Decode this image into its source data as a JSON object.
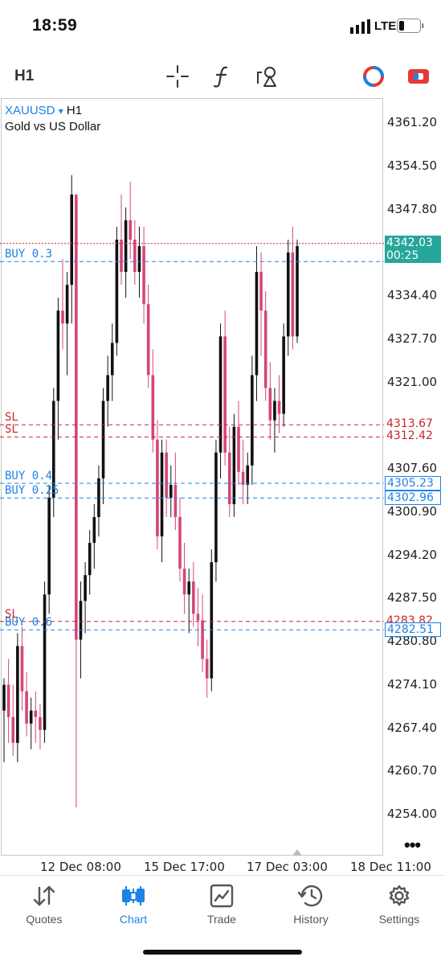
{
  "status_bar": {
    "time": "18:59",
    "network": "LTE"
  },
  "toolbar": {
    "timeframe": "H1",
    "icons": [
      "crosshair-icon",
      "function-icon",
      "objects-icon",
      "trade-recorder-icon",
      "one-click-trade-icon"
    ]
  },
  "symbol": {
    "name": "XAUUSD",
    "arrow": "▾",
    "timeframe": "H1",
    "description": "Gold vs US Dollar"
  },
  "price_axis": {
    "labels": [
      "4361.20",
      "4354.50",
      "4347.80",
      "4334.40",
      "4327.70",
      "4321.00",
      "4307.60",
      "4300.90",
      "4294.20",
      "4287.50",
      "4280.80",
      "4274.10",
      "4267.40",
      "4260.70",
      "4254.00"
    ]
  },
  "time_axis": {
    "labels": [
      "12 Dec 08:00",
      "15 Dec 17:00",
      "17 Dec 03:00",
      "18 Dec 11:00"
    ]
  },
  "current_price": {
    "value": "4342.03",
    "timer": "00:25",
    "color": "#26a69a"
  },
  "colors": {
    "bull": "#111111",
    "bear": "#d4467a",
    "buy_line": "#1e82e6",
    "sl_line": "#c62828"
  },
  "trade_lines": [
    {
      "label": "BUY 0.3",
      "price": 4339.6,
      "type": "buy",
      "badge": ""
    },
    {
      "label": "SL",
      "price": 4314.3,
      "type": "sl",
      "badge": "4313.67"
    },
    {
      "label": "SL",
      "price": 4312.42,
      "type": "sl",
      "badge": "4312.42"
    },
    {
      "label": "BUY 0.4",
      "price": 4305.23,
      "type": "buy",
      "badge": "4305.23"
    },
    {
      "label": "BUY 0.25",
      "price": 4302.96,
      "type": "buy",
      "badge": "4302.96"
    },
    {
      "label": "SL",
      "price": 4283.82,
      "type": "sl",
      "badge": "4283.82"
    },
    {
      "label": "BUY 0.6",
      "price": 4282.51,
      "type": "buy",
      "badge": "4282.51"
    }
  ],
  "chart_data": {
    "type": "candlestick",
    "symbol": "XAUUSD",
    "timeframe": "H1",
    "ylim": [
      4251.0,
      4364.5
    ],
    "current_price": 4342.03,
    "candles": [
      {
        "o": 4270,
        "h": 4275,
        "l": 4262,
        "c": 4274
      },
      {
        "o": 4274,
        "h": 4278,
        "l": 4265,
        "c": 4269
      },
      {
        "o": 4269,
        "h": 4274,
        "l": 4263,
        "c": 4265
      },
      {
        "o": 4265,
        "h": 4282,
        "l": 4262,
        "c": 4280
      },
      {
        "o": 4280,
        "h": 4283,
        "l": 4270,
        "c": 4273
      },
      {
        "o": 4273,
        "h": 4276,
        "l": 4266,
        "c": 4268
      },
      {
        "o": 4268,
        "h": 4272,
        "l": 4264,
        "c": 4270
      },
      {
        "o": 4270,
        "h": 4273,
        "l": 4265,
        "c": 4269
      },
      {
        "o": 4269,
        "h": 4271,
        "l": 4264,
        "c": 4267
      },
      {
        "o": 4267,
        "h": 4290,
        "l": 4265,
        "c": 4288
      },
      {
        "o": 4288,
        "h": 4305,
        "l": 4285,
        "c": 4303
      },
      {
        "o": 4303,
        "h": 4320,
        "l": 4300,
        "c": 4318
      },
      {
        "o": 4318,
        "h": 4334,
        "l": 4312,
        "c": 4332
      },
      {
        "o": 4332,
        "h": 4340,
        "l": 4326,
        "c": 4330
      },
      {
        "o": 4330,
        "h": 4338,
        "l": 4322,
        "c": 4336
      },
      {
        "o": 4336,
        "h": 4353,
        "l": 4330,
        "c": 4350
      },
      {
        "o": 4350,
        "h": 4348,
        "l": 4255,
        "c": 4281
      },
      {
        "o": 4281,
        "h": 4290,
        "l": 4275,
        "c": 4287
      },
      {
        "o": 4287,
        "h": 4293,
        "l": 4282,
        "c": 4291
      },
      {
        "o": 4291,
        "h": 4298,
        "l": 4288,
        "c": 4296
      },
      {
        "o": 4296,
        "h": 4302,
        "l": 4292,
        "c": 4300
      },
      {
        "o": 4300,
        "h": 4308,
        "l": 4297,
        "c": 4306
      },
      {
        "o": 4306,
        "h": 4320,
        "l": 4302,
        "c": 4318
      },
      {
        "o": 4318,
        "h": 4325,
        "l": 4314,
        "c": 4322
      },
      {
        "o": 4322,
        "h": 4330,
        "l": 4318,
        "c": 4327
      },
      {
        "o": 4327,
        "h": 4345,
        "l": 4325,
        "c": 4343
      },
      {
        "o": 4343,
        "h": 4350,
        "l": 4336,
        "c": 4338
      },
      {
        "o": 4338,
        "h": 4348,
        "l": 4334,
        "c": 4346
      },
      {
        "o": 4346,
        "h": 4352,
        "l": 4340,
        "c": 4343
      },
      {
        "o": 4343,
        "h": 4346,
        "l": 4336,
        "c": 4338
      },
      {
        "o": 4338,
        "h": 4345,
        "l": 4334,
        "c": 4342
      },
      {
        "o": 4342,
        "h": 4345,
        "l": 4330,
        "c": 4333
      },
      {
        "o": 4333,
        "h": 4336,
        "l": 4320,
        "c": 4322
      },
      {
        "o": 4322,
        "h": 4326,
        "l": 4310,
        "c": 4312
      },
      {
        "o": 4312,
        "h": 4315,
        "l": 4295,
        "c": 4297
      },
      {
        "o": 4297,
        "h": 4312,
        "l": 4293,
        "c": 4310
      },
      {
        "o": 4310,
        "h": 4312,
        "l": 4300,
        "c": 4303
      },
      {
        "o": 4303,
        "h": 4308,
        "l": 4300,
        "c": 4305
      },
      {
        "o": 4305,
        "h": 4310,
        "l": 4298,
        "c": 4300
      },
      {
        "o": 4300,
        "h": 4303,
        "l": 4290,
        "c": 4292
      },
      {
        "o": 4292,
        "h": 4296,
        "l": 4285,
        "c": 4288
      },
      {
        "o": 4288,
        "h": 4292,
        "l": 4282,
        "c": 4290
      },
      {
        "o": 4290,
        "h": 4293,
        "l": 4283,
        "c": 4285
      },
      {
        "o": 4285,
        "h": 4289,
        "l": 4280,
        "c": 4284
      },
      {
        "o": 4284,
        "h": 4288,
        "l": 4276,
        "c": 4278
      },
      {
        "o": 4278,
        "h": 4281,
        "l": 4272,
        "c": 4275
      },
      {
        "o": 4275,
        "h": 4295,
        "l": 4273,
        "c": 4293
      },
      {
        "o": 4293,
        "h": 4312,
        "l": 4290,
        "c": 4310
      },
      {
        "o": 4310,
        "h": 4330,
        "l": 4306,
        "c": 4328
      },
      {
        "o": 4328,
        "h": 4332,
        "l": 4308,
        "c": 4310
      },
      {
        "o": 4310,
        "h": 4314,
        "l": 4300,
        "c": 4302
      },
      {
        "o": 4302,
        "h": 4316,
        "l": 4300,
        "c": 4314
      },
      {
        "o": 4314,
        "h": 4318,
        "l": 4305,
        "c": 4307
      },
      {
        "o": 4307,
        "h": 4312,
        "l": 4302,
        "c": 4305
      },
      {
        "o": 4305,
        "h": 4310,
        "l": 4302,
        "c": 4308
      },
      {
        "o": 4308,
        "h": 4325,
        "l": 4305,
        "c": 4322
      },
      {
        "o": 4322,
        "h": 4342,
        "l": 4318,
        "c": 4338
      },
      {
        "o": 4338,
        "h": 4341,
        "l": 4325,
        "c": 4332
      },
      {
        "o": 4332,
        "h": 4335,
        "l": 4318,
        "c": 4320
      },
      {
        "o": 4320,
        "h": 4324,
        "l": 4312,
        "c": 4315
      },
      {
        "o": 4315,
        "h": 4320,
        "l": 4310,
        "c": 4318
      },
      {
        "o": 4318,
        "h": 4322,
        "l": 4313,
        "c": 4316
      },
      {
        "o": 4316,
        "h": 4330,
        "l": 4314,
        "c": 4328
      },
      {
        "o": 4328,
        "h": 4343,
        "l": 4325,
        "c": 4341
      },
      {
        "o": 4341,
        "h": 4345,
        "l": 4326,
        "c": 4328
      },
      {
        "o": 4328,
        "h": 4343,
        "l": 4327,
        "c": 4342
      }
    ]
  },
  "bottom_nav": [
    {
      "label": "Quotes",
      "icon": "quotes-arrows-icon",
      "active": false
    },
    {
      "label": "Chart",
      "icon": "candles-icon",
      "active": true
    },
    {
      "label": "Trade",
      "icon": "trade-chart-icon",
      "active": false
    },
    {
      "label": "History",
      "icon": "history-clock-icon",
      "active": false
    },
    {
      "label": "Settings",
      "icon": "gear-icon",
      "active": false
    }
  ]
}
